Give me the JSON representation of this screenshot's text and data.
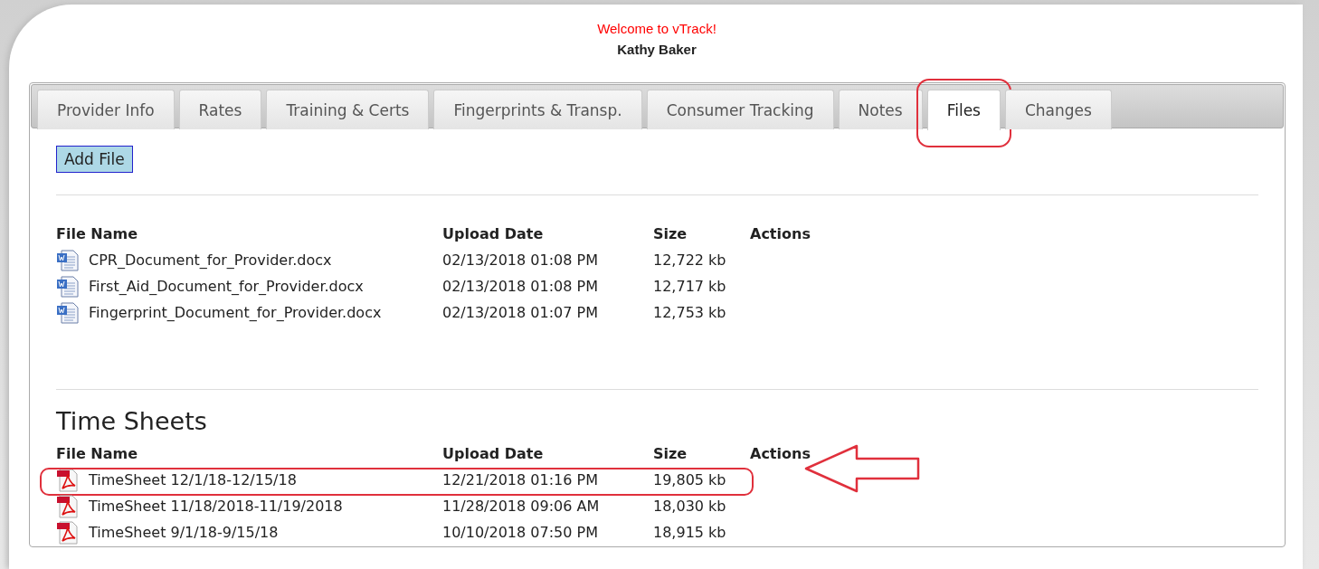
{
  "header": {
    "welcome": "Welcome to vTrack!",
    "user": "Kathy Baker"
  },
  "tabs": [
    {
      "label": "Provider Info",
      "selected": false,
      "circled": false
    },
    {
      "label": "Rates",
      "selected": false,
      "circled": false
    },
    {
      "label": "Training & Certs",
      "selected": false,
      "circled": false
    },
    {
      "label": "Fingerprints & Transp.",
      "selected": false,
      "circled": false
    },
    {
      "label": "Consumer Tracking",
      "selected": false,
      "circled": false
    },
    {
      "label": "Notes",
      "selected": false,
      "circled": false
    },
    {
      "label": "Files",
      "selected": true,
      "circled": true
    },
    {
      "label": "Changes",
      "selected": false,
      "circled": false
    }
  ],
  "add_button": "Add File",
  "sections": [
    {
      "columns": [
        "File Name",
        "Upload Date",
        "Size",
        "Actions"
      ],
      "rows": [
        {
          "kind": "word",
          "name": "CPR_Document_for_Provider.docx",
          "date": "02/13/2018 01:08 PM",
          "size": "12,722 kb",
          "circled": false
        },
        {
          "kind": "word",
          "name": "First_Aid_Document_for_Provider.docx",
          "date": "02/13/2018 01:08 PM",
          "size": "12,717 kb",
          "circled": false
        },
        {
          "kind": "word",
          "name": "Fingerprint_Document_for_Provider.docx",
          "date": "02/13/2018 01:07 PM",
          "size": "12,753 kb",
          "circled": false
        }
      ]
    },
    {
      "title": "Time Sheets",
      "columns": [
        "File Name",
        "Upload Date",
        "Size",
        "Actions"
      ],
      "rows": [
        {
          "kind": "pdf",
          "name": "TimeSheet 12/1/18-12/15/18",
          "date": "12/21/2018 01:16 PM",
          "size": "19,805 kb",
          "circled": true
        },
        {
          "kind": "pdf",
          "name": "TimeSheet 11/18/2018-11/19/2018",
          "date": "11/28/2018 09:06 AM",
          "size": "18,030 kb",
          "circled": false
        },
        {
          "kind": "pdf",
          "name": "TimeSheet 9/1/18-9/15/18",
          "date": "10/10/2018 07:50 PM",
          "size": "18,915 kb",
          "circled": false
        }
      ]
    }
  ]
}
